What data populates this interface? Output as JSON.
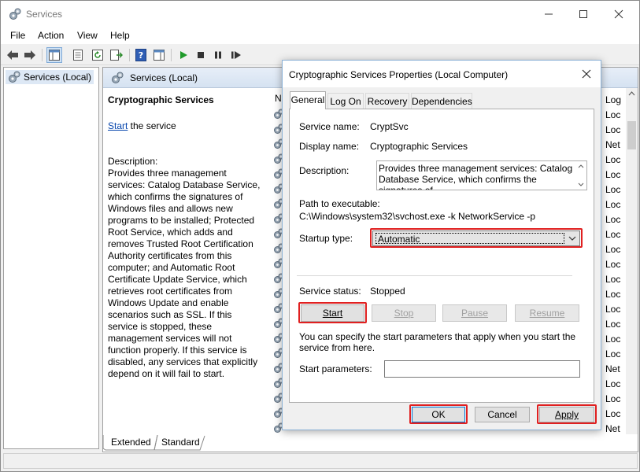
{
  "window": {
    "title": "Services",
    "menu": [
      "File",
      "Action",
      "View",
      "Help"
    ]
  },
  "tree": {
    "root_label": "Services (Local)"
  },
  "pane": {
    "header_title": "Services (Local)",
    "service_name": "Cryptographic Services",
    "start_link": "Start",
    "start_suffix": " the service",
    "description_label": "Description:",
    "description_text": "Provides three management services: Catalog Database Service, which confirms the signatures of Windows files and allows new programs to be installed; Protected Root Service, which adds and removes Trusted Root Certification Authority certificates from this computer; and Automatic Root Certificate Update Service, which retrieves root certificates from Windows Update and enable scenarios such as SSL. If this service is stopped, these management services will not function properly. If this service is disabled, any services that explicitly depend on it will fail to start.",
    "list_header_partial": "N",
    "log_header": "Log",
    "log_on_values": [
      "Loc",
      "Loc",
      "Net",
      "Loc",
      "Loc",
      "Loc",
      "Loc",
      "Loc",
      "Loc",
      "Loc",
      "Loc",
      "Loc",
      "Loc",
      "Loc",
      "Loc",
      "Loc",
      "Loc",
      "Net",
      "Loc",
      "Loc",
      "Loc",
      "Net"
    ],
    "bottom_tabs": [
      "Extended",
      "Standard"
    ]
  },
  "dialog": {
    "title": "Cryptographic Services Properties (Local Computer)",
    "tabs": [
      "General",
      "Log On",
      "Recovery",
      "Dependencies"
    ],
    "service_name_label": "Service name:",
    "service_name_value": "CryptSvc",
    "display_name_label": "Display name:",
    "display_name_value": "Cryptographic Services",
    "description_label": "Description:",
    "description_value": "Provides three management services: Catalog Database Service, which confirms the signatures of",
    "path_label": "Path to executable:",
    "path_value": "C:\\Windows\\system32\\svchost.exe -k NetworkService -p",
    "startup_type_label": "Startup type:",
    "startup_type_value": "Automatic",
    "service_status_label": "Service status:",
    "service_status_value": "Stopped",
    "buttons": {
      "start": "Start",
      "stop": "Stop",
      "pause": "Pause",
      "resume": "Resume"
    },
    "params_hint": "You can specify the start parameters that apply when you start the service from here.",
    "start_params_label": "Start parameters:",
    "footer": {
      "ok": "OK",
      "cancel": "Cancel",
      "apply": "Apply"
    }
  },
  "colors": {
    "highlight": "#e02020",
    "link": "#0645ad",
    "selection": "#dde8f5"
  }
}
